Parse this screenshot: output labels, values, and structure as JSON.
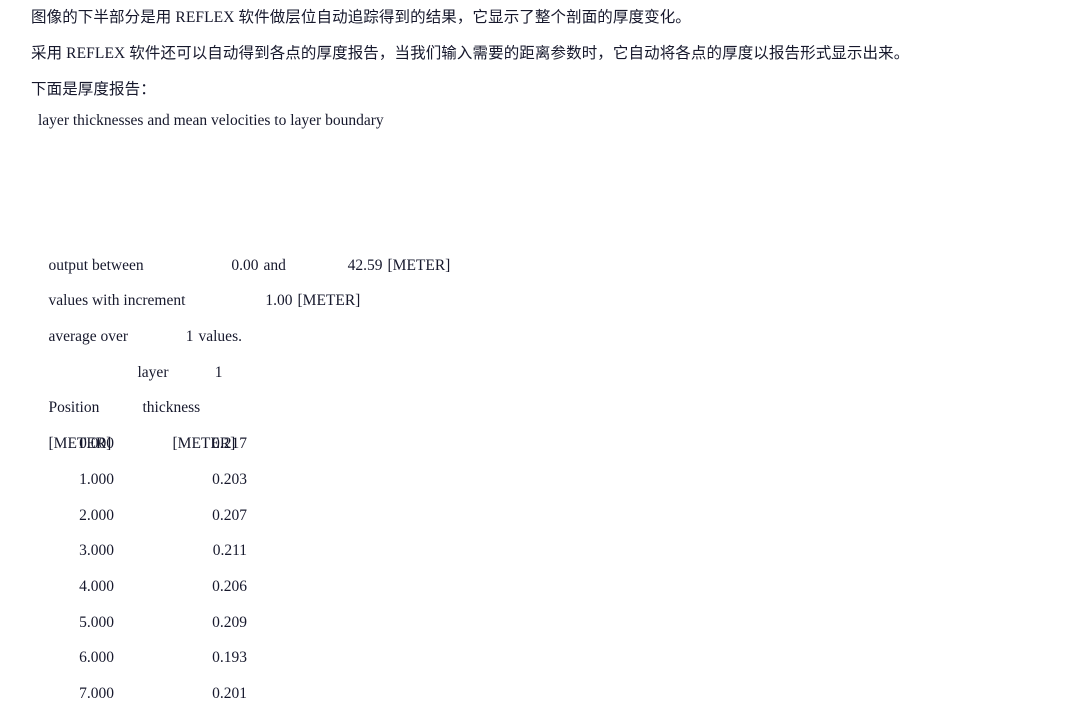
{
  "document": {
    "prose_lines": [
      "图像的下半部分是用 REFLEX 软件做层位自动追踪得到的结果，它显示了整个剖面的厚度变化。",
      "采用 REFLEX 软件还可以自动得到各点的厚度报告，当我们输入需要的距离参数时，它自动将各点的厚度以报告形式显示出来。",
      "下面是厚度报告："
    ],
    "report_heading": "layer thicknesses and mean velocities to layer boundary"
  },
  "report": {
    "output_between": {
      "label": "output between",
      "start_value": "0.00",
      "conjunction": "and",
      "end_value": "42.59",
      "unit": "[METER]"
    },
    "increment": {
      "label": "values with increment",
      "value": "1.00",
      "unit": "[METER]"
    },
    "average": {
      "label": "average over",
      "value": "1",
      "suffix": "values."
    },
    "layer": {
      "label": "layer",
      "number": "1"
    },
    "columns": {
      "position_header": "Position",
      "thickness_header": "thickness",
      "position_unit": "[METER]",
      "thickness_unit": "[METER]"
    },
    "rows": [
      {
        "position": "0.000",
        "thickness": "0.217"
      },
      {
        "position": "1.000",
        "thickness": "0.203"
      },
      {
        "position": "2.000",
        "thickness": "0.207"
      },
      {
        "position": "3.000",
        "thickness": "0.211"
      },
      {
        "position": "4.000",
        "thickness": "0.206"
      },
      {
        "position": "5.000",
        "thickness": "0.209"
      },
      {
        "position": "6.000",
        "thickness": "0.193"
      },
      {
        "position": "7.000",
        "thickness": "0.201"
      }
    ]
  },
  "colors": {
    "text": "#16182c",
    "background": "#ffffff"
  }
}
